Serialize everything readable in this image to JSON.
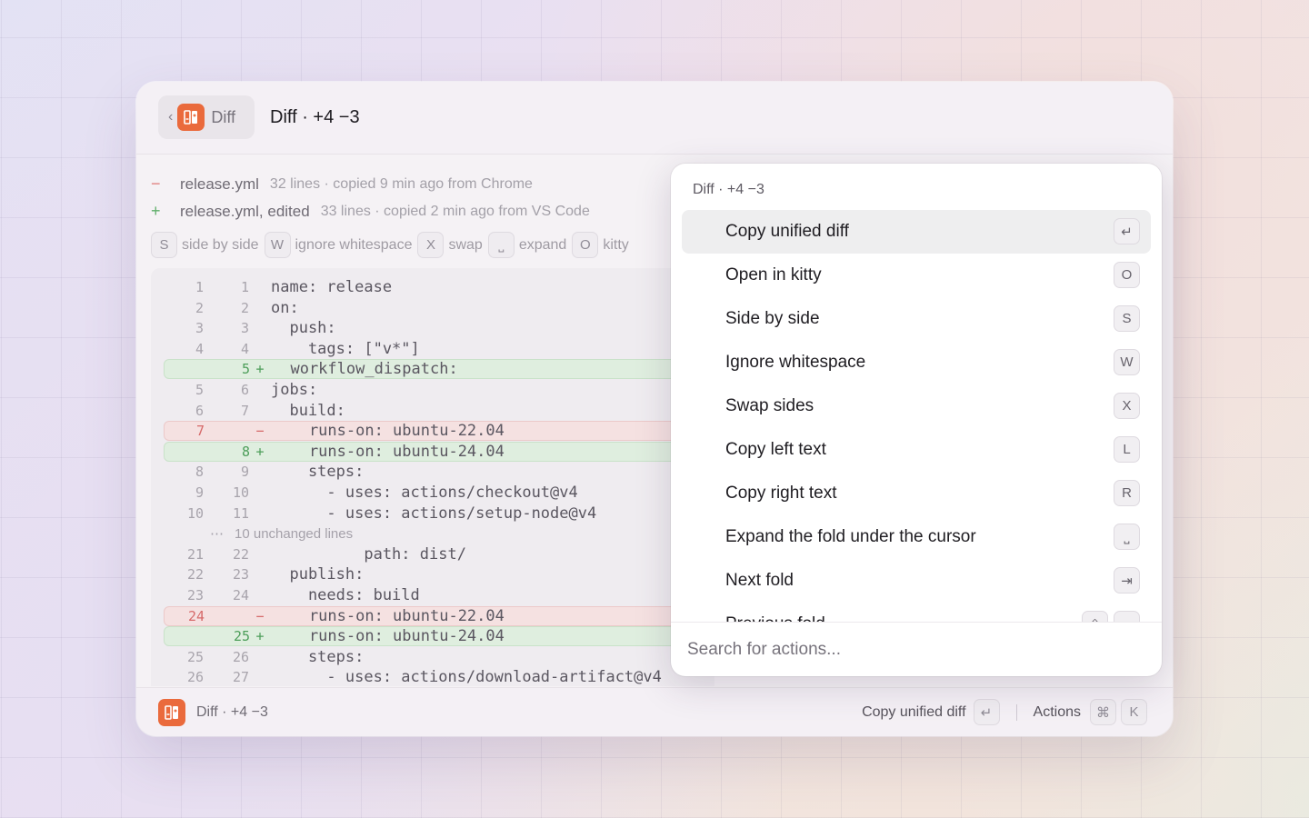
{
  "header": {
    "back_label": "Diff",
    "title": "Diff · +4 −3"
  },
  "files": [
    {
      "sign": "−",
      "name": "release.yml",
      "meta": "32 lines · copied 9 min ago from Chrome",
      "color": "#e07a7a"
    },
    {
      "sign": "+",
      "name": "release.yml, edited",
      "meta": "33 lines · copied 2 min ago from VS Code",
      "color": "#5fae6a"
    }
  ],
  "hints": [
    {
      "key": "S",
      "label": "side by side"
    },
    {
      "key": "W",
      "label": "ignore whitespace"
    },
    {
      "key": "X",
      "label": "swap"
    },
    {
      "key": "⎵",
      "label": "expand"
    },
    {
      "key": "O",
      "label": "kitty"
    }
  ],
  "code": {
    "lines": [
      {
        "type": "ctx",
        "l": "1",
        "r": "1",
        "mark": "",
        "text": "name: release"
      },
      {
        "type": "ctx",
        "l": "2",
        "r": "2",
        "mark": "",
        "text": "on:"
      },
      {
        "type": "ctx",
        "l": "3",
        "r": "3",
        "mark": "",
        "text": "  push:"
      },
      {
        "type": "ctx",
        "l": "4",
        "r": "4",
        "mark": "",
        "text": "    tags: [\"v*\"]"
      },
      {
        "type": "add",
        "l": "",
        "r": "5",
        "mark": "+",
        "text": "  workflow_dispatch:"
      },
      {
        "type": "ctx",
        "l": "5",
        "r": "6",
        "mark": "",
        "text": "jobs:"
      },
      {
        "type": "ctx",
        "l": "6",
        "r": "7",
        "mark": "",
        "text": "  build:"
      },
      {
        "type": "del",
        "l": "7",
        "r": "",
        "mark": "−",
        "text": "    runs-on: ubuntu-22.04"
      },
      {
        "type": "add",
        "l": "",
        "r": "8",
        "mark": "+",
        "text": "    runs-on: ubuntu-24.04"
      },
      {
        "type": "ctx",
        "l": "8",
        "r": "9",
        "mark": "",
        "text": "    steps:"
      },
      {
        "type": "ctx",
        "l": "9",
        "r": "10",
        "mark": "",
        "text": "      - uses: actions/checkout@v4"
      },
      {
        "type": "ctx",
        "l": "10",
        "r": "11",
        "mark": "",
        "text": "      - uses: actions/setup-node@v4"
      },
      {
        "type": "fold",
        "text": "10 unchanged lines"
      },
      {
        "type": "ctx",
        "l": "21",
        "r": "22",
        "mark": "",
        "text": "          path: dist/"
      },
      {
        "type": "ctx",
        "l": "22",
        "r": "23",
        "mark": "",
        "text": "  publish:"
      },
      {
        "type": "ctx",
        "l": "23",
        "r": "24",
        "mark": "",
        "text": "    needs: build"
      },
      {
        "type": "del",
        "l": "24",
        "r": "",
        "mark": "−",
        "text": "    runs-on: ubuntu-22.04"
      },
      {
        "type": "add",
        "l": "",
        "r": "25",
        "mark": "+",
        "text": "    runs-on: ubuntu-24.04"
      },
      {
        "type": "ctx",
        "l": "25",
        "r": "26",
        "mark": "",
        "text": "    steps:"
      },
      {
        "type": "ctx",
        "l": "26",
        "r": "27",
        "mark": "",
        "text": "      - uses: actions/download-artifact@v4"
      }
    ]
  },
  "palette": {
    "title": "Diff · +4 −3",
    "items": [
      {
        "label": "Copy unified diff",
        "keys": [
          "↵"
        ],
        "selected": true
      },
      {
        "label": "Open in kitty",
        "keys": [
          "O"
        ]
      },
      {
        "label": "Side by side",
        "keys": [
          "S"
        ]
      },
      {
        "label": "Ignore whitespace",
        "keys": [
          "W"
        ]
      },
      {
        "label": "Swap sides",
        "keys": [
          "X"
        ]
      },
      {
        "label": "Copy left text",
        "keys": [
          "L"
        ]
      },
      {
        "label": "Copy right text",
        "keys": [
          "R"
        ]
      },
      {
        "label": "Expand the fold under the cursor",
        "keys": [
          "⎵"
        ]
      },
      {
        "label": "Next fold",
        "keys": [
          "⇥"
        ]
      },
      {
        "label": "Previous fold",
        "keys": [
          "⇧",
          "⇥"
        ]
      }
    ],
    "search_placeholder": "Search for actions..."
  },
  "footer": {
    "title": "Diff · +4 −3",
    "primary_action": "Copy unified diff",
    "primary_key": "↵",
    "actions_label": "Actions",
    "actions_keys": [
      "⌘",
      "K"
    ]
  },
  "colors": {
    "accent": "#ea6a3c",
    "add": "#5fae6a",
    "del": "#e07a7a"
  }
}
